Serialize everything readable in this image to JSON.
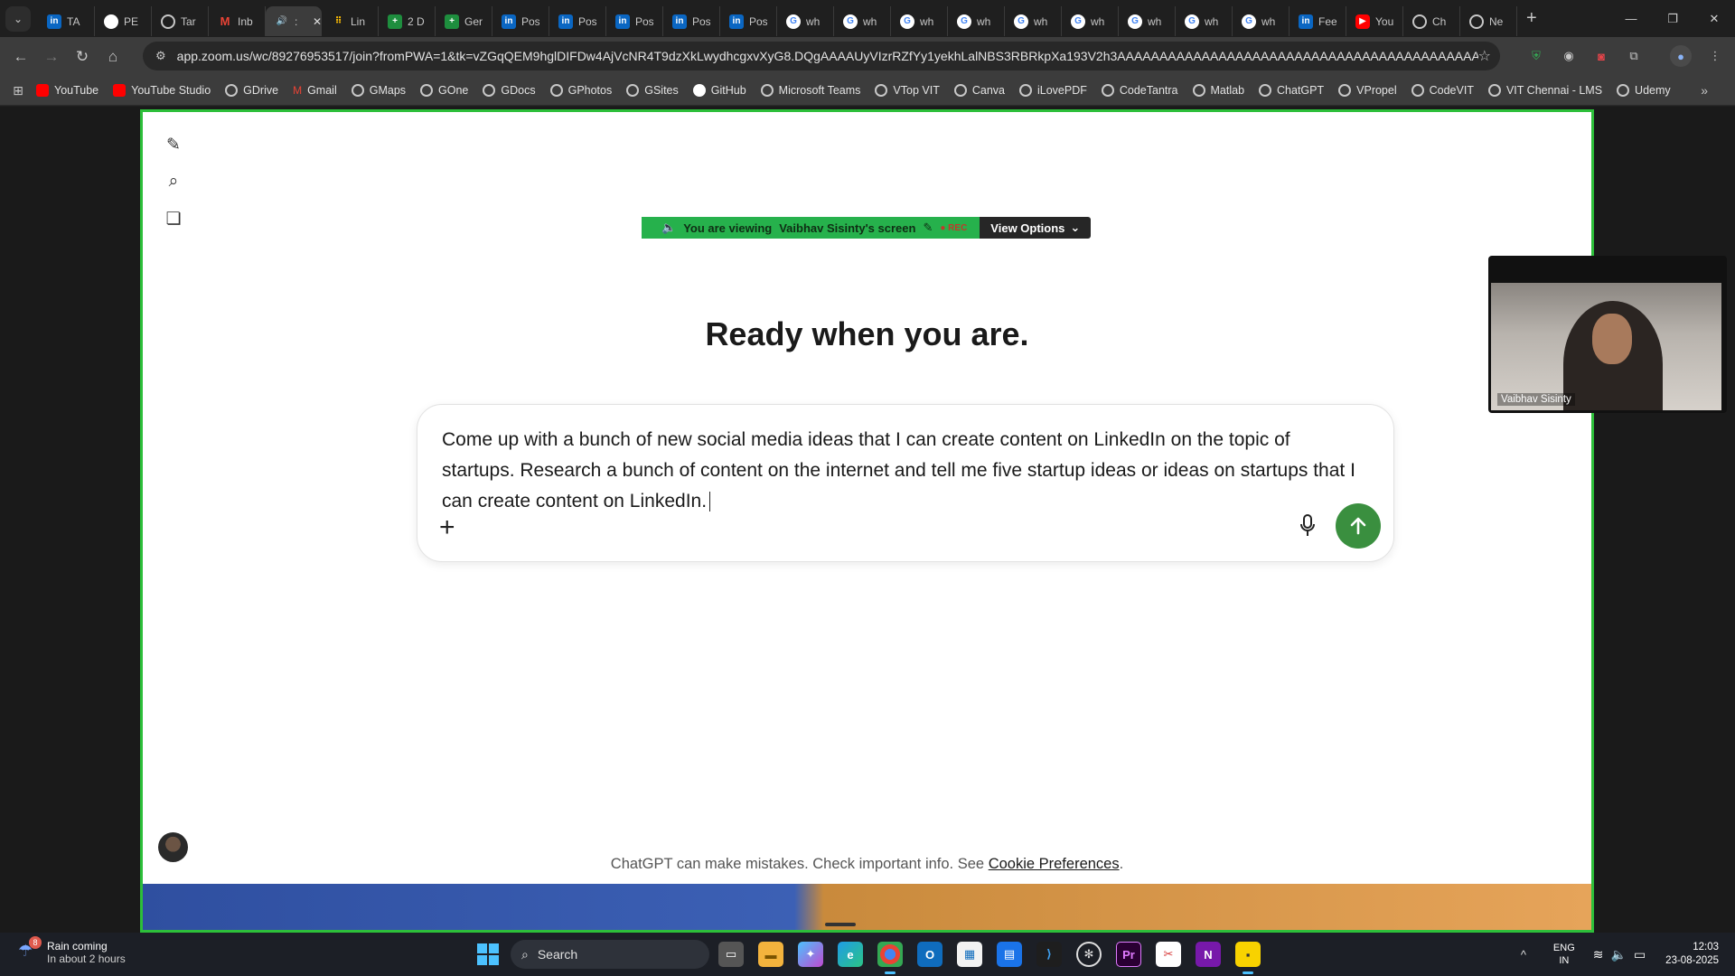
{
  "browser": {
    "tabs": [
      {
        "icon": "linkedin-icon",
        "title": "TA"
      },
      {
        "icon": "github-icon",
        "title": "PE"
      },
      {
        "icon": "globe-icon",
        "title": "Tar"
      },
      {
        "icon": "gmail-icon",
        "title": "Inb"
      },
      {
        "icon": "audio-icon",
        "title": ":",
        "active": true
      },
      {
        "icon": "dots-icon",
        "title": "Lin"
      },
      {
        "icon": "sheets-icon",
        "title": "2 D"
      },
      {
        "icon": "sheets-icon",
        "title": "Ger"
      },
      {
        "icon": "linkedin-icon",
        "title": "Pos"
      },
      {
        "icon": "linkedin-icon",
        "title": "Pos"
      },
      {
        "icon": "linkedin-icon",
        "title": "Pos"
      },
      {
        "icon": "linkedin-icon",
        "title": "Pos"
      },
      {
        "icon": "linkedin-icon",
        "title": "Pos"
      },
      {
        "icon": "google-icon",
        "title": "wh"
      },
      {
        "icon": "google-icon",
        "title": "wh"
      },
      {
        "icon": "google-icon",
        "title": "wh"
      },
      {
        "icon": "google-icon",
        "title": "wh"
      },
      {
        "icon": "google-icon",
        "title": "wh"
      },
      {
        "icon": "google-icon",
        "title": "wh"
      },
      {
        "icon": "google-icon",
        "title": "wh"
      },
      {
        "icon": "google-icon",
        "title": "wh"
      },
      {
        "icon": "google-icon",
        "title": "wh"
      },
      {
        "icon": "linkedin-icon",
        "title": "Fee"
      },
      {
        "icon": "youtube-icon",
        "title": "You"
      },
      {
        "icon": "openai-icon",
        "title": "Ch"
      },
      {
        "icon": "globe-icon",
        "title": "Ne"
      }
    ],
    "url": "app.zoom.us/wc/89276953517/join?fromPWA=1&tk=vZGqQEM9hglDIFDw4AjVcNR4T9dzXkLwydhcgxvXyG8.DQgAAAAUyVIzrRZfYy1yekhLalNBS3RBRkpXa193V2h3AAAAAAAAAAAAAAAAAAAAAAAAAAAAAAAAAAAAAAAAAAAA&_x_zm_r...",
    "bookmarks": [
      "YouTube",
      "YouTube Studio",
      "GDrive",
      "Gmail",
      "GMaps",
      "GOne",
      "GDocs",
      "GPhotos",
      "GSites",
      "GitHub",
      "Microsoft Teams",
      "VTop VIT",
      "Canva",
      "iLovePDF",
      "CodeTantra",
      "Matlab",
      "ChatGPT",
      "VPropel",
      "CodeVIT",
      "VIT Chennai - LMS",
      "Udemy"
    ]
  },
  "zoom": {
    "banner_viewing": "You are viewing",
    "banner_name": "Vaibhav Sisinty's screen",
    "banner_rec": "REC",
    "view_options": "View Options",
    "participant_name": "Vaibhav Sisinty"
  },
  "chatgpt": {
    "heading": "Ready when you are.",
    "prompt": "Come up with a bunch of new social media ideas that I can create content on LinkedIn on the topic of startups. Research a bunch of content on the internet and tell me five startup ideas or ideas on startups that I can create content on LinkedIn.",
    "disclaimer": "ChatGPT can make mistakes. Check important info. See",
    "disclaimer_link": "Cookie Preferences",
    "disclaimer_end": "."
  },
  "taskbar": {
    "weather_badge": "8",
    "weather_title": "Rain coming",
    "weather_sub": "In about 2 hours",
    "search_label": "Search",
    "lang_1": "ENG",
    "lang_2": "IN",
    "time": "12:03",
    "date": "23-08-2025"
  },
  "colors": {
    "share_border": "#2dbf3a",
    "send_button": "#3a8f3f"
  }
}
